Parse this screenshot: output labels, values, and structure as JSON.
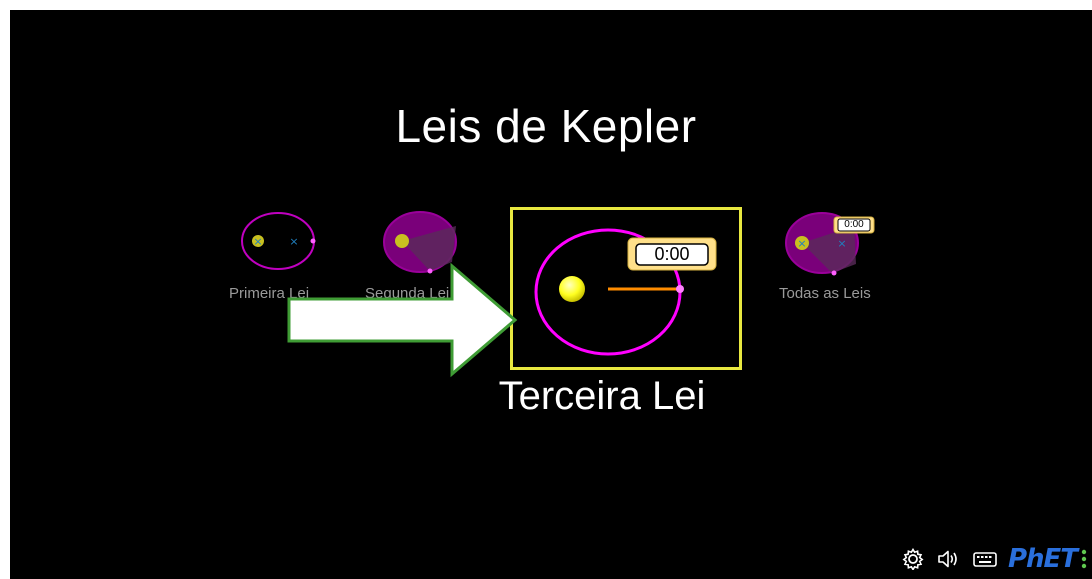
{
  "home": {
    "title": "Leis de Kepler"
  },
  "screens": [
    {
      "label": "Primeira Lei",
      "visible_label": "Primeira Lei"
    },
    {
      "label": "Segunda Lei",
      "visible_label": "Segunda Lei"
    },
    {
      "label": "Terceira Lei",
      "selected": true,
      "timer": "0:00"
    },
    {
      "label": "Todas as Leis",
      "timer": "0:00"
    }
  ],
  "annotation": {
    "arrow_color": "#ffffff",
    "arrow_border": "#3f9c35"
  },
  "navbar": {
    "icons": [
      "settings-icon",
      "audio-icon",
      "keyboard-icon"
    ],
    "logo": "PhET"
  },
  "colors": {
    "background": "#000000",
    "orbit": "#ff00ff",
    "sun": "#ffff00",
    "selection_border": "#e8e840",
    "radius_line": "#ff8c00",
    "timer_bg": "#ffe08a"
  }
}
